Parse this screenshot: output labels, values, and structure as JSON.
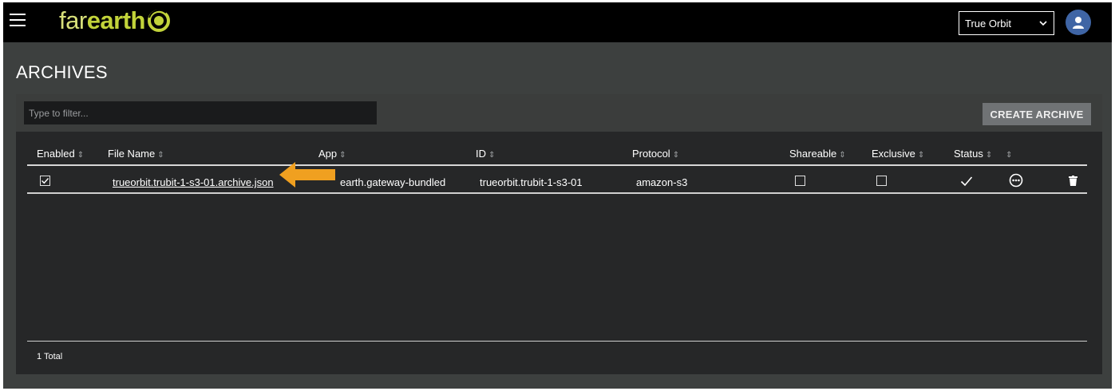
{
  "app": {
    "logo_left": "far",
    "logo_right": "earth",
    "menu_icon": "hamburger-menu-icon",
    "org_selected": "True Orbit",
    "user_icon": "user-avatar-icon"
  },
  "page": {
    "title": "ARCHIVES"
  },
  "toolbar": {
    "filter_placeholder": "Type to filter...",
    "filter_value": "",
    "create_label": "CREATE ARCHIVE"
  },
  "table": {
    "columns": [
      "Enabled",
      "File Name",
      "App",
      "ID",
      "Protocol",
      "Shareable",
      "Exclusive",
      "Status",
      ""
    ],
    "sort_glyph": "⇕",
    "rows": [
      {
        "enabled": true,
        "file_name": "trueorbit.trubit-1-s3-01.archive.json",
        "app": "earth.gateway-bundled",
        "id": "trueorbit.trubit-1-s3-01",
        "protocol": "amazon-s3",
        "shareable": false,
        "exclusive": false,
        "status": "check-icon",
        "actions": [
          "more-options-icon",
          "trash-icon"
        ]
      }
    ],
    "total_label": "1 Total"
  },
  "annotation": {
    "arrow_color": "#f0a020"
  },
  "colors": {
    "topbar": "#000000",
    "page_bg": "#3d403f",
    "panel_bg": "#262728",
    "panel_head_bg": "#3b3d3c",
    "logo_far": "#d8e07a",
    "logo_earth": "#c2d33a",
    "avatar": "#3f65a5",
    "create_button": "#707375"
  }
}
